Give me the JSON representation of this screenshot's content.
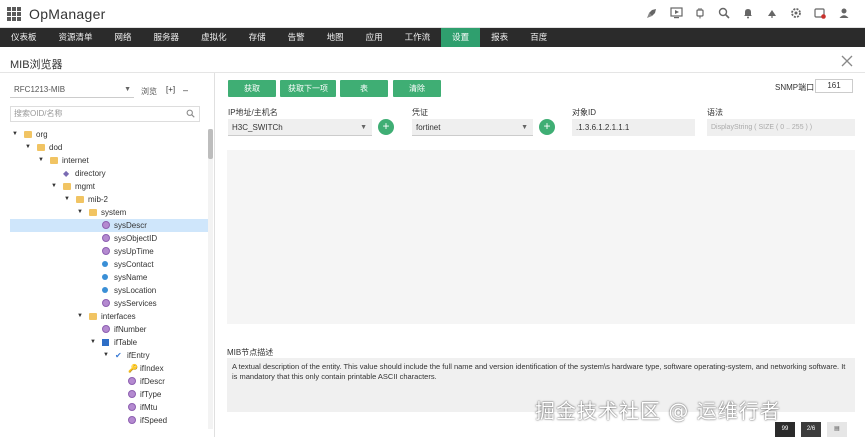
{
  "app": {
    "title": "OpManager"
  },
  "header_icons": [
    "rocket-icon",
    "monitor-icon",
    "plug-icon",
    "search-icon",
    "bell-icon",
    "alarm-icon",
    "settings-icon",
    "alert-badge-icon",
    "user-icon"
  ],
  "nav": {
    "items": [
      "仪表板",
      "资源清单",
      "网络",
      "服务器",
      "虚拟化",
      "存储",
      "告警",
      "地图",
      "应用",
      "工作流",
      "设置",
      "报表",
      "百度"
    ],
    "active": "设置"
  },
  "page": {
    "title": "MIB浏览器"
  },
  "left": {
    "mib_select": "RFC1213-MIB",
    "browse": "浏览",
    "expand": "[+]",
    "collapse": "–",
    "search_placeholder": "搜索OID/名称",
    "tree": [
      {
        "label": "org",
        "depth": 0,
        "icon": "folder",
        "twisty": "open"
      },
      {
        "label": "dod",
        "depth": 1,
        "icon": "folder",
        "twisty": "open"
      },
      {
        "label": "internet",
        "depth": 2,
        "icon": "folder",
        "twisty": "open"
      },
      {
        "label": "directory",
        "depth": 3,
        "icon": "dir",
        "twisty": ""
      },
      {
        "label": "mgmt",
        "depth": 3,
        "icon": "folder",
        "twisty": "open"
      },
      {
        "label": "mib-2",
        "depth": 4,
        "icon": "folder",
        "twisty": "open"
      },
      {
        "label": "system",
        "depth": 5,
        "icon": "folder",
        "twisty": "open"
      },
      {
        "label": "sysDescr",
        "depth": 6,
        "icon": "purple",
        "twisty": "",
        "selected": true
      },
      {
        "label": "sysObjectID",
        "depth": 6,
        "icon": "purple",
        "twisty": ""
      },
      {
        "label": "sysUpTime",
        "depth": 6,
        "icon": "purple",
        "twisty": ""
      },
      {
        "label": "sysContact",
        "depth": 6,
        "icon": "blue",
        "twisty": ""
      },
      {
        "label": "sysName",
        "depth": 6,
        "icon": "blue",
        "twisty": ""
      },
      {
        "label": "sysLocation",
        "depth": 6,
        "icon": "blue",
        "twisty": ""
      },
      {
        "label": "sysServices",
        "depth": 6,
        "icon": "purple",
        "twisty": ""
      },
      {
        "label": "interfaces",
        "depth": 5,
        "icon": "folder",
        "twisty": "open"
      },
      {
        "label": "ifNumber",
        "depth": 6,
        "icon": "purple",
        "twisty": ""
      },
      {
        "label": "ifTable",
        "depth": 6,
        "icon": "square",
        "twisty": "open"
      },
      {
        "label": "ifEntry",
        "depth": 7,
        "icon": "entry",
        "twisty": "open"
      },
      {
        "label": "ifIndex",
        "depth": 8,
        "icon": "key",
        "twisty": ""
      },
      {
        "label": "ifDescr",
        "depth": 8,
        "icon": "purple",
        "twisty": ""
      },
      {
        "label": "ifType",
        "depth": 8,
        "icon": "purple",
        "twisty": ""
      },
      {
        "label": "ifMtu",
        "depth": 8,
        "icon": "purple",
        "twisty": ""
      },
      {
        "label": "ifSpeed",
        "depth": 8,
        "icon": "purple",
        "twisty": ""
      }
    ]
  },
  "toolbar": {
    "get": "获取",
    "get_next": "获取下一项",
    "table": "表",
    "clear": "清除",
    "snmp_port_label": "SNMP端口",
    "snmp_port": "161"
  },
  "form": {
    "host_label": "IP地址/主机名",
    "host_value": "H3C_SWITCh",
    "credential_label": "凭证",
    "credential_value": "fortinet",
    "oid_label": "对象ID",
    "oid_value": ".1.3.6.1.2.1.1.1",
    "syntax_label": "语法",
    "syntax_value": "DisplayString ( SIZE ( 0 .. 255 ) )"
  },
  "description": {
    "label": "MIB节点描述",
    "text": "A textual description of the entity. This value should include the full name and version identification of the system\\s hardware type, software operating-system, and networking software. It is mandatory that this only contain printable ASCII characters."
  },
  "watermark": "掘金技术社区 @ 运维行者",
  "corner": {
    "a": "99",
    "b": "2/6"
  },
  "colors": {
    "accent": "#3fae74",
    "nav_bg": "#2b2b2b",
    "nav_active": "#2f9f6e",
    "selection": "#cfe6fb"
  }
}
